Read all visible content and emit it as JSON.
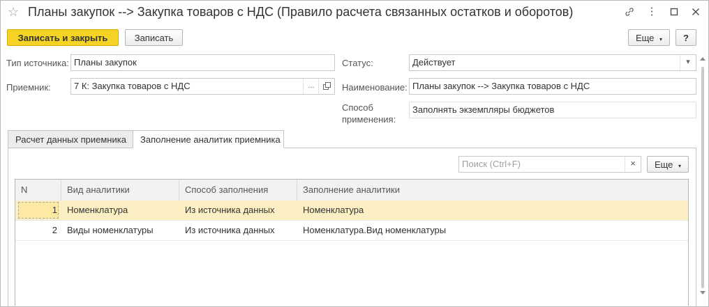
{
  "window": {
    "title": "Планы закупок --> Закупка товаров с НДС (Правило расчета связанных остатков и оборотов)"
  },
  "titlebar_icons": [
    "star-icon",
    "link-icon",
    "more-icon",
    "maximize-icon",
    "close-icon"
  ],
  "toolbar": {
    "save_close_label": "Записать и закрыть",
    "save_label": "Записать",
    "more_label": "Еще",
    "help_label": "?"
  },
  "form": {
    "source_type_label": "Тип источника:",
    "source_type_value": "Планы закупок",
    "receiver_label": "Приемник:",
    "receiver_value": "7 К: Закупка товаров с НДС",
    "status_label": "Статус:",
    "status_value": "Действует",
    "name_label": "Наименование:",
    "name_value": "Планы закупок --> Закупка товаров с НДС",
    "method_label_1": "Способ",
    "method_label_2": "применения:",
    "method_value": "Заполнять экземпляры бюджетов"
  },
  "tabs": [
    {
      "label": "Расчет данных приемника",
      "active": false
    },
    {
      "label": "Заполнение аналитик приемника",
      "active": true
    }
  ],
  "search": {
    "placeholder": "Поиск (Ctrl+F)",
    "clear": "×",
    "more_label": "Еще"
  },
  "table": {
    "columns": [
      "N",
      "Вид аналитики",
      "Способ заполнения",
      "Заполнение аналитики"
    ],
    "rows": [
      {
        "n": "1",
        "kind": "Номенклатура",
        "method": "Из источника данных",
        "fill": "Номенклатура",
        "selected": true
      },
      {
        "n": "2",
        "kind": "Виды номенклатуры",
        "method": "Из источника данных",
        "fill": "Номенклатура.Вид номенклатуры",
        "selected": false
      }
    ]
  }
}
